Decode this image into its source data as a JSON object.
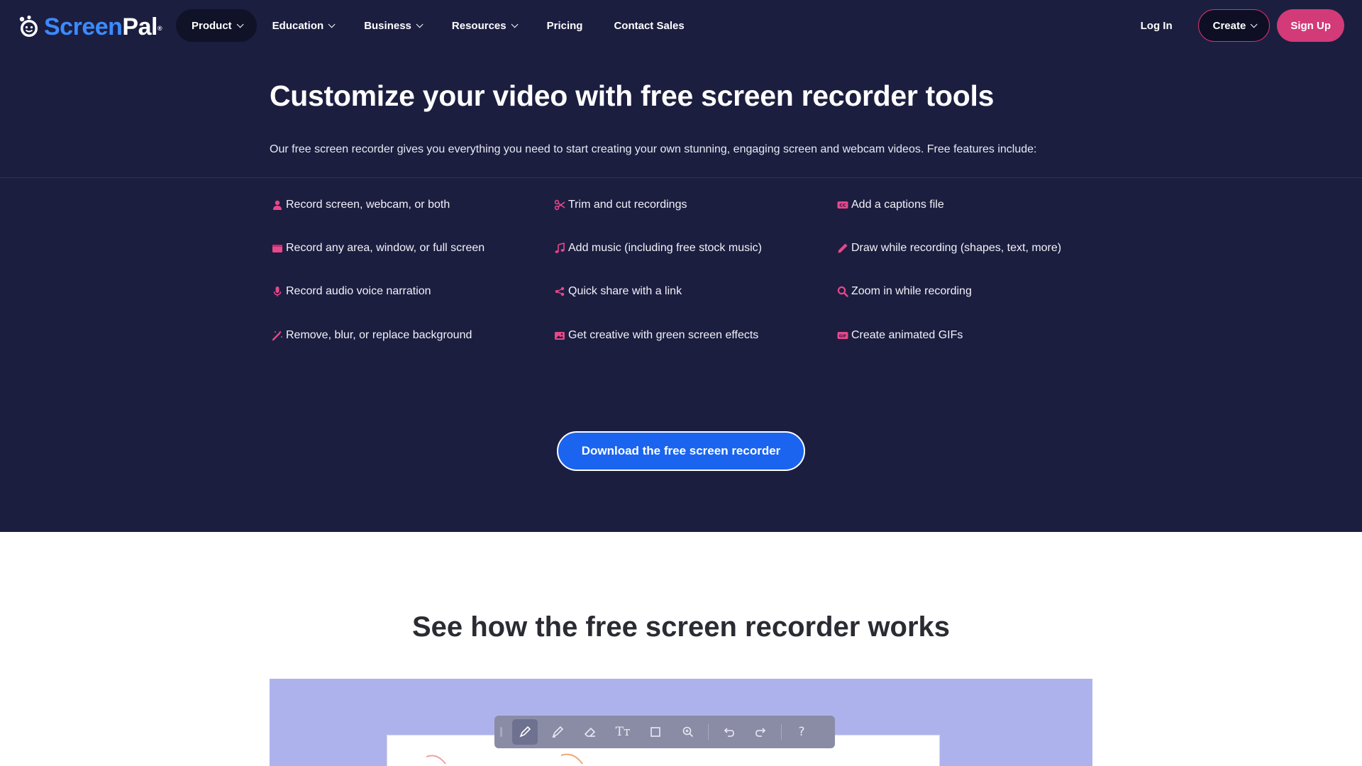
{
  "brand": {
    "name_prefix": "Screen",
    "name_suffix": "Pal",
    "trademark": "®"
  },
  "nav": {
    "items": [
      {
        "label": "Product",
        "dropdown": true
      },
      {
        "label": "Education",
        "dropdown": true
      },
      {
        "label": "Business",
        "dropdown": true
      },
      {
        "label": "Resources",
        "dropdown": true
      },
      {
        "label": "Pricing",
        "dropdown": false
      },
      {
        "label": "Contact Sales",
        "dropdown": false
      }
    ],
    "login": "Log In",
    "create": "Create",
    "signup": "Sign Up"
  },
  "hero": {
    "title": "Customize your video with free screen recorder tools",
    "description": "Our free screen recorder gives you everything you need to start creating your own stunning, engaging screen and webcam videos. Free features include:"
  },
  "features": [
    {
      "label": "Record screen, webcam, or both",
      "icon": "person-icon"
    },
    {
      "label": "Record any area, window, or full screen",
      "icon": "window-icon"
    },
    {
      "label": "Record audio voice narration",
      "icon": "microphone-icon"
    },
    {
      "label": "Remove, blur, or replace background",
      "icon": "magic-wand-icon"
    },
    {
      "label": "Trim and cut recordings",
      "icon": "scissors-icon"
    },
    {
      "label": "Add music (including free stock music)",
      "icon": "music-note-icon"
    },
    {
      "label": "Quick share with a link",
      "icon": "share-icon"
    },
    {
      "label": "Get creative with green screen effects",
      "icon": "image-icon"
    },
    {
      "label": "Add a captions file",
      "icon": "captions-icon"
    },
    {
      "label": "Draw while recording (shapes, text, more)",
      "icon": "pen-icon"
    },
    {
      "label": "Zoom in while recording",
      "icon": "zoom-icon"
    },
    {
      "label": "Create animated GIFs",
      "icon": "gif-icon"
    }
  ],
  "cta": {
    "label": "Download the free screen recorder"
  },
  "how": {
    "title": "See how the free screen recorder works"
  },
  "demo_toolbar": {
    "text_tool_label": "Tт",
    "help_label": "?"
  },
  "colors": {
    "dark_bg": "#1c1e40",
    "accent_pink": "#d23a78",
    "cta_blue": "#1a64f0",
    "demo_bg": "#aeb2ec"
  }
}
